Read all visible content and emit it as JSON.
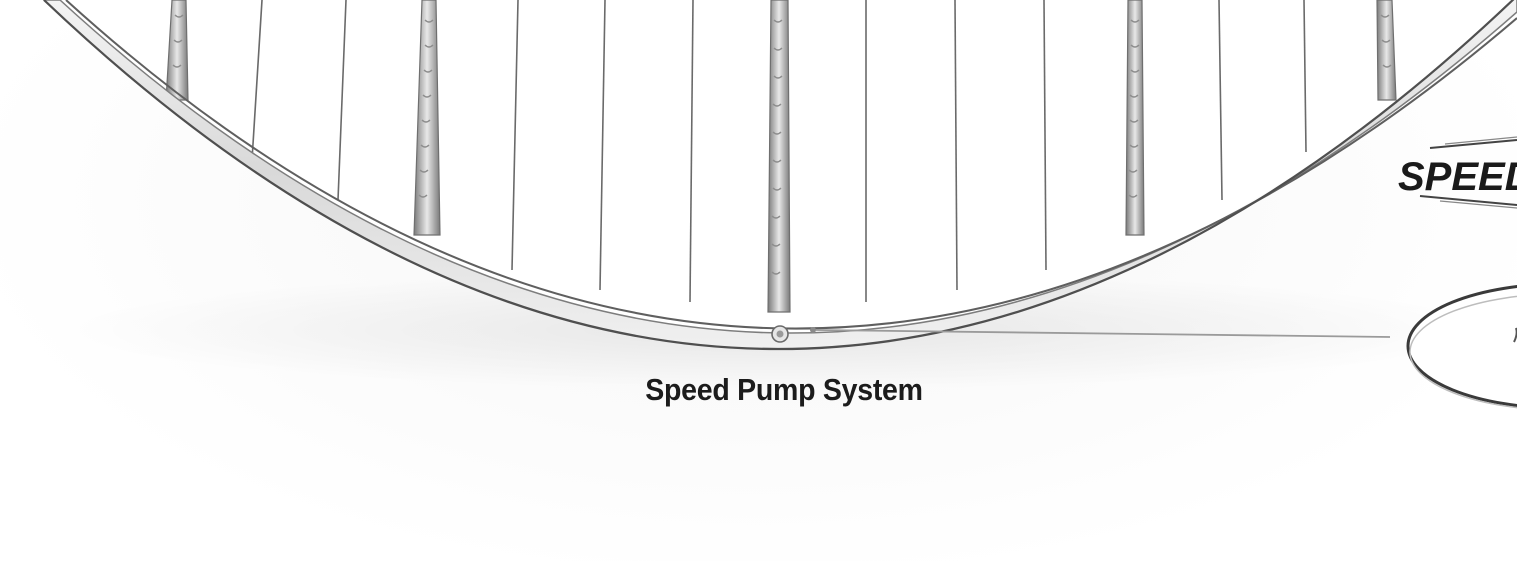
{
  "diagram": {
    "callout_label": "Speed Pump System",
    "logo_text": "SPEED",
    "colors": {
      "frame_stroke": "#8a8a8a",
      "frame_fill": "#e9e9e9",
      "rib_stroke": "#6f6f6f",
      "panel_fill": "#ffffff",
      "leader_line": "#9a9a9a",
      "caption_text": "#1c1c1c"
    }
  }
}
